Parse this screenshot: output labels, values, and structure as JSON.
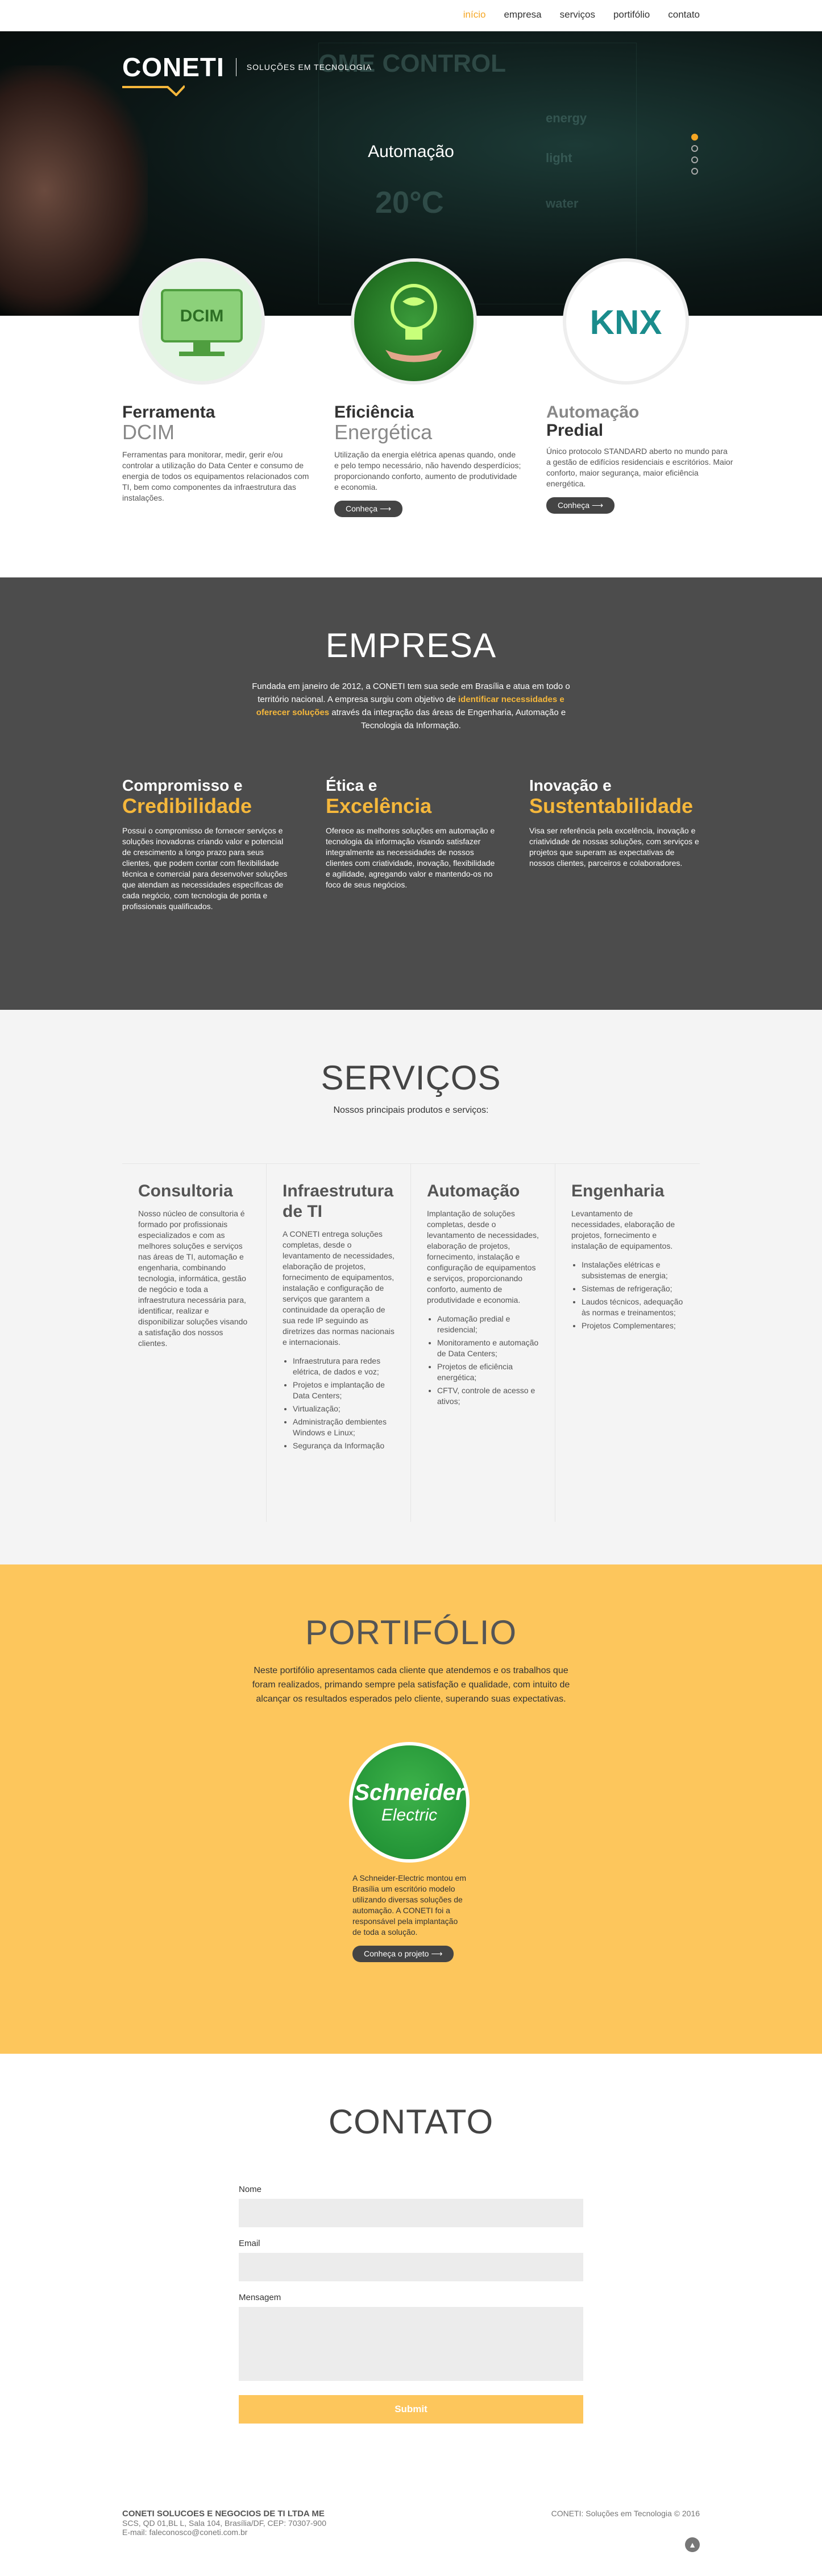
{
  "nav": {
    "items": [
      "início",
      "empresa",
      "serviços",
      "portifólio",
      "contato"
    ]
  },
  "hero": {
    "logo": "CONETI",
    "logo_sub": "SOLUÇÕES EM TECNOLOGIA",
    "title": "Automação",
    "background_text": [
      "OME CONTROL",
      "energy",
      "light",
      "water",
      "20°C"
    ],
    "active_slide": 1
  },
  "features": [
    {
      "title": "Ferramenta",
      "big": "DCIM",
      "icon": "DCIM",
      "text": "Ferramentas para monitorar, medir, gerir e/ou controlar a utilização do Data Center e consumo de energia de todos os equipamentos relacionados com TI, bem como componentes da infraestrutura das instalações.",
      "button": ""
    },
    {
      "title": "Eficiência",
      "big": "Energética",
      "icon": "",
      "text": "Utilização da energia elétrica apenas quando, onde e pelo tempo necessário, não havendo desperdícios; proporcionando conforto, aumento de produtividade e economia.",
      "button": "Conheça"
    },
    {
      "title": "Automação",
      "big": "Predial",
      "icon": "KNX",
      "text": "Único protocolo STANDARD aberto no mundo para a gestão de edifícios residenciais e escritórios. Maior conforto, maior segurança, maior eficiência energética.",
      "button": "Conheça"
    }
  ],
  "empresa": {
    "title": "EMPRESA",
    "intro_a": "Fundada em janeiro de 2012, a CONETI tem sua sede em Brasília e atua em todo o território nacional. A empresa surgiu com objetivo de ",
    "intro_b": "identificar necessidades e oferecer soluções",
    "intro_c": " através da integração das áreas de Engenharia, Automação e Tecnologia da Informação.",
    "cols": [
      {
        "a": "Compromisso e",
        "b": "Credibilidade",
        "text": "Possui o compromisso de fornecer serviços e soluções inovadoras criando valor e potencial de crescimento a longo prazo para seus clientes, que podem contar com flexibilidade técnica e comercial para desenvolver soluções que atendam as necessidades específicas de cada negócio, com tecnologia de ponta e profissionais qualificados."
      },
      {
        "a": "Ética e",
        "b": "Excelência",
        "text": "Oferece as melhores soluções em automação e tecnologia da informação visando satisfazer integralmente as necessidades de nossos clientes com criatividade, inovação, flexibilidade e agilidade, agregando valor e mantendo-os no foco de seus negócios."
      },
      {
        "a": "Inovação e",
        "b": "Sustentabilidade",
        "text": "Visa ser referência pela excelência, inovação e criatividade de nossas soluções, com serviços e projetos que superam as expectativas de nossos clientes, parceiros e colaboradores."
      }
    ]
  },
  "servicos": {
    "title": "SERVIÇOS",
    "subtitle": "Nossos principais produtos e serviços:",
    "items": [
      {
        "title": "Consultoria",
        "text": "Nosso núcleo de consultoria é formado por profissionais especializados e com as melhores soluções e serviços nas áreas de TI, automação e engenharia, combinando tecnologia, informática, gestão de negócio e toda a infraestrutura necessária para, identificar, realizar e disponibilizar soluções visando a satisfação dos nossos clientes.",
        "list": []
      },
      {
        "title": "Infraestrutura de TI",
        "text": "A CONETI entrega soluções completas, desde o levantamento de necessidades, elaboração de projetos, fornecimento de equipamentos, instalação e configuração de serviços que garantem a continuidade da operação de sua rede IP seguindo as diretrizes das normas nacionais e internacionais.",
        "list": [
          "Infraestrutura para redes elétrica, de dados e voz;",
          "Projetos e implantação de Data Centers;",
          "Virtualização;",
          "Administração dembientes Windows e Linux;",
          "Segurança da Informação"
        ]
      },
      {
        "title": "Automação",
        "text": "Implantação de soluções completas, desde o levantamento de necessidades, elaboração de projetos, fornecimento, instalação e configuração de equipamentos e serviços, proporcionando conforto, aumento de produtividade e economia.",
        "list": [
          "Automação predial e residencial;",
          "Monitoramento e automação de Data Centers;",
          "Projetos de eficiência energética;",
          "CFTV, controle de acesso e ativos;"
        ]
      },
      {
        "title": "Engenharia",
        "text": "Levantamento de necessidades, elaboração de projetos, fornecimento e instalação de equipamentos.",
        "list": [
          "Instalações elétricas e subsistemas de energia;",
          "Sistemas de refrigeração;",
          "Laudos técnicos, adequação às normas e treinamentos;",
          "Projetos Complementares;"
        ]
      }
    ]
  },
  "portfolio": {
    "title": "PORTIFÓLIO",
    "intro": "Neste portifólio apresentamos cada cliente que atendemos e os trabalhos que foram realizados, primando sempre pela satisfação e qualidade, com intuito de alcançar os resultados esperados pelo cliente, superando suas expectativas.",
    "card_logo_1": "Schneider",
    "card_logo_2": "Electric",
    "card_text": "A Schneider-Electric montou em Brasília um escritório modelo utilizando diversas soluções de automação. A CONETI foi a responsável pela implantação de toda a solução.",
    "card_button": "Conheça o projeto"
  },
  "contato": {
    "title": "CONTATO",
    "name_label": "Nome",
    "email_label": "Email",
    "message_label": "Mensagem",
    "submit": "Submit"
  },
  "footer": {
    "company": "CONETI SOLUCOES E NEGOCIOS DE TI LTDA ME",
    "address": "SCS, QD 01,BL L, Sala 104, Brasília/DF, CEP: 70307-900",
    "email": "E-mail: faleconosco@coneti.com.br",
    "copyright": "CONETI: Soluções em Tecnologia © 2016"
  }
}
